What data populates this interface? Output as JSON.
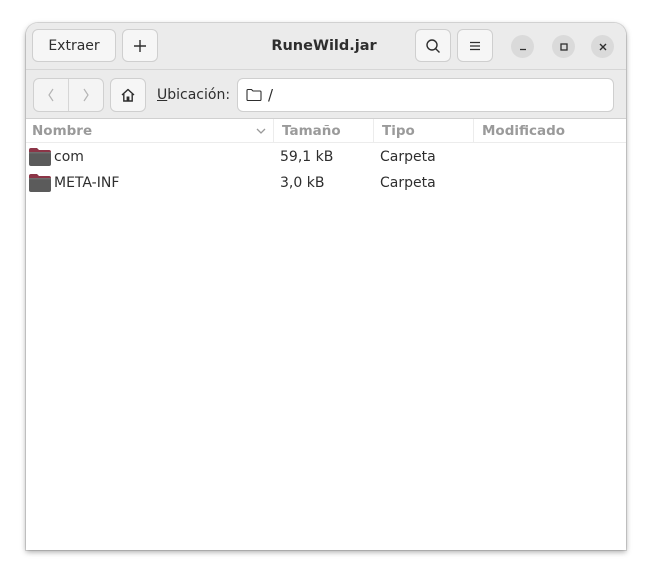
{
  "window": {
    "title": "RuneWild.jar"
  },
  "toolbar": {
    "extract_label": "Extraer",
    "add_icon": "plus-icon",
    "search_icon": "search-icon",
    "menu_icon": "hamburger-menu-icon"
  },
  "window_controls": {
    "minimize_icon": "minimize-icon",
    "maximize_icon": "maximize-icon",
    "close_icon": "close-icon"
  },
  "location": {
    "label": "Ubicación:",
    "label_mnemonic": "U",
    "label_rest": "bicación:",
    "path": "/"
  },
  "columns": {
    "name": "Nombre",
    "size": "Tamaño",
    "type": "Tipo",
    "modified": "Modificado"
  },
  "files": [
    {
      "name": "com",
      "size": "59,1 kB",
      "type": "Carpeta",
      "modified": ""
    },
    {
      "name": "META-INF",
      "size": "3,0 kB",
      "type": "Carpeta",
      "modified": ""
    }
  ],
  "colors": {
    "titlebar_bg": "#ebebeb",
    "folder_dark": "#5b5b5b",
    "folder_accent": "#8c3547",
    "header_text": "#9a9a9a"
  }
}
